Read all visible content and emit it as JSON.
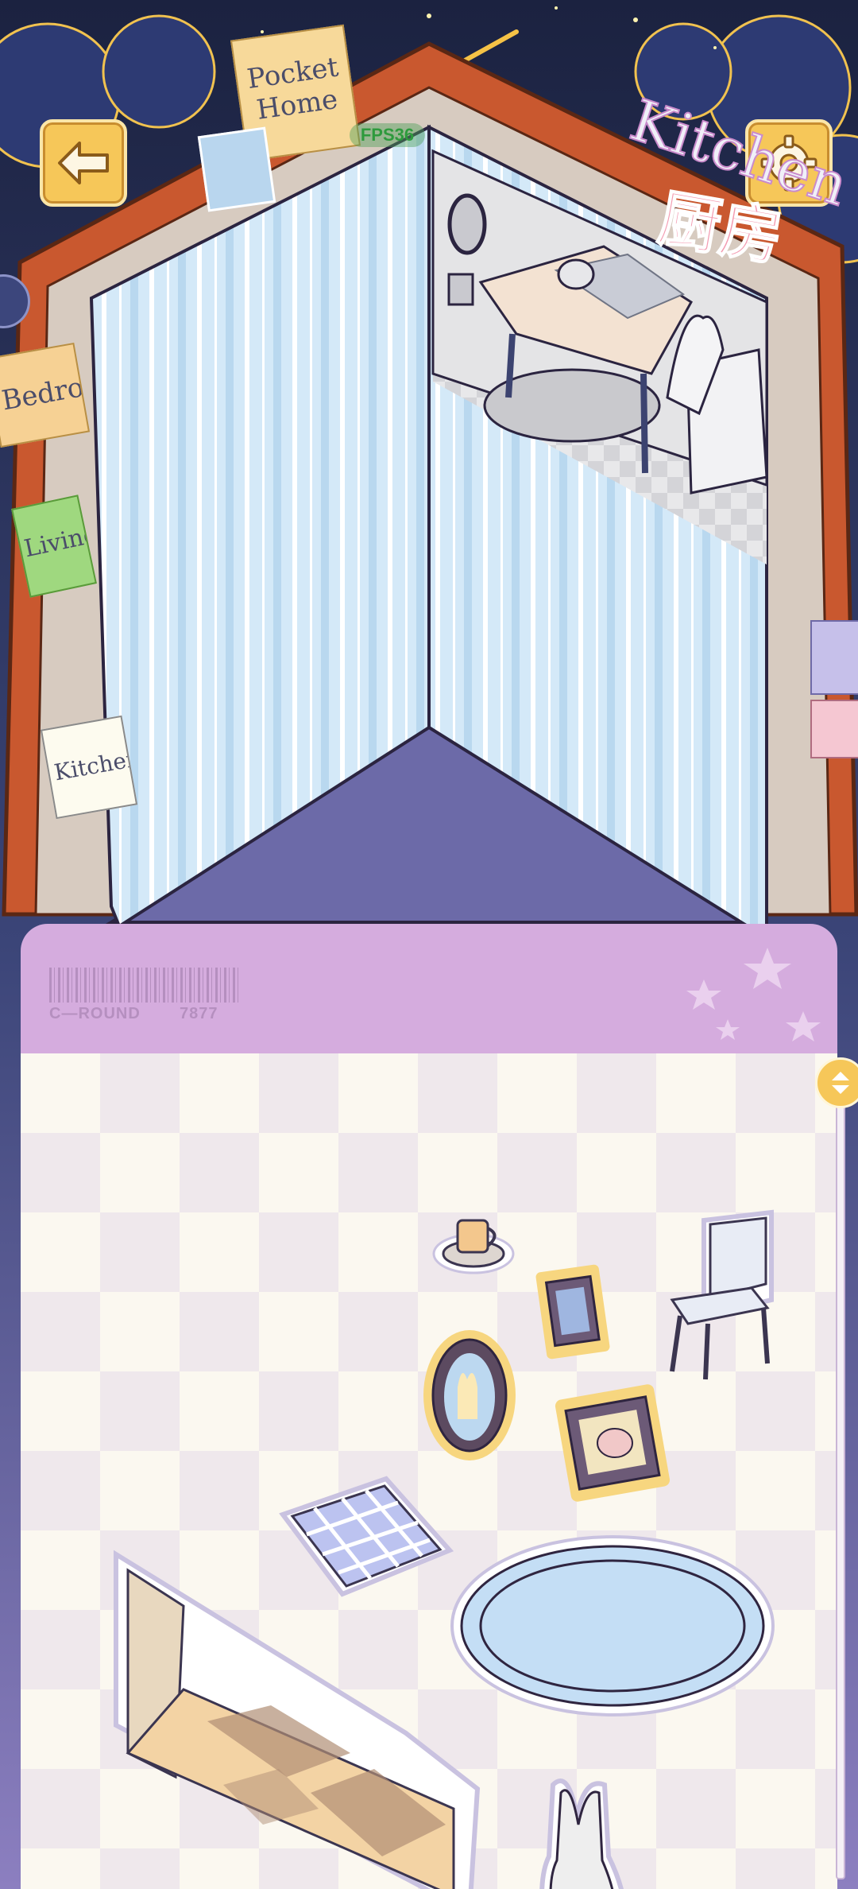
{
  "header": {
    "back_icon": "back-arrow-icon",
    "settings_icon": "gear-icon",
    "fps_text": "FPS36"
  },
  "scene": {
    "title_note": "Pocket Home",
    "room_en": "Kitchen",
    "room_cn": "厨房",
    "side_tabs": [
      "Bedroo",
      "Living",
      "Kitchen"
    ]
  },
  "panel": {
    "round_label": "C—ROUND",
    "round_number": "7877"
  },
  "stickers": [
    "teacup",
    "small-picture-frame",
    "chair",
    "oval-mirror",
    "pig-picture-frame",
    "checked-tablecloth",
    "oval-rug",
    "room-corner-floor",
    "bunny-ghost"
  ],
  "colors": {
    "sky": "#1f2a4d",
    "book_cover": "#c9582f",
    "wallpaper": "#cfe6f7",
    "panel_head": "#d5acde",
    "button": "#f6c759"
  }
}
